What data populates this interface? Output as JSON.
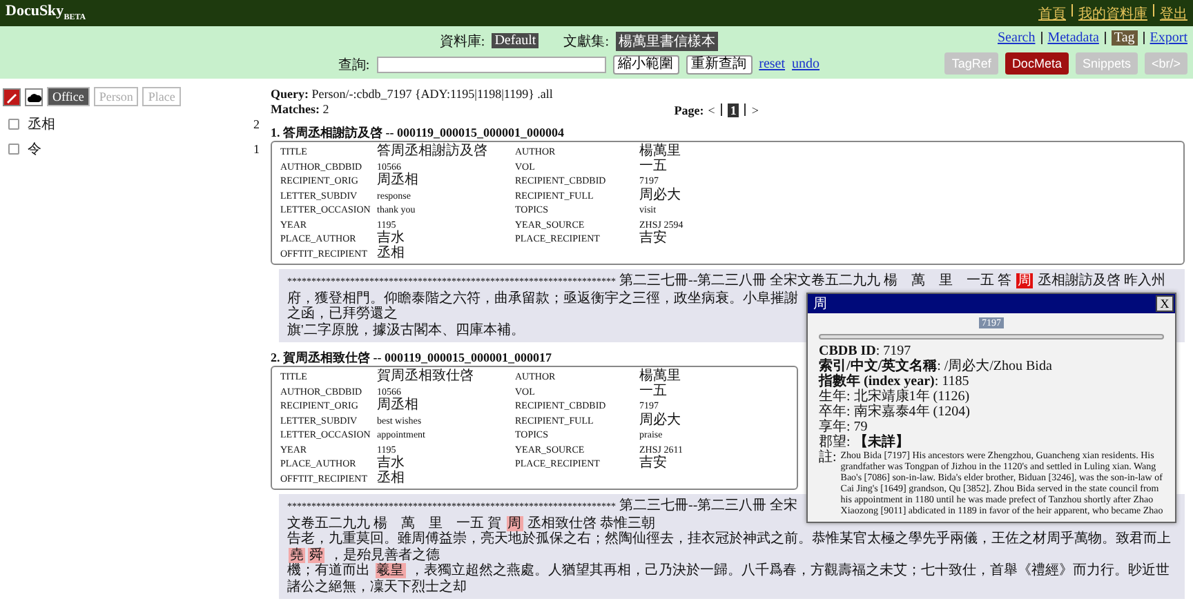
{
  "app": {
    "name": "DocuSky",
    "badge": "BETA"
  },
  "top_links": [
    "首頁",
    "我的資料庫",
    "登出"
  ],
  "database": {
    "label": "資料庫:",
    "value": "Default"
  },
  "corpus": {
    "label": "文獻集:",
    "value": "楊萬里書信樣本"
  },
  "query_bar": {
    "label": "查詢:",
    "buttons": [
      "縮小範圍",
      "重新查詢"
    ],
    "links": [
      "reset",
      "undo"
    ]
  },
  "view_links": [
    {
      "label": "Search",
      "selected": false
    },
    {
      "label": "Metadata",
      "selected": false
    },
    {
      "label": "Tag",
      "selected": true
    },
    {
      "label": "Export",
      "selected": false
    }
  ],
  "tool_buttons": [
    {
      "label": "TagRef",
      "selected": false
    },
    {
      "label": "DocMeta",
      "selected": true
    },
    {
      "label": "Snippets",
      "selected": false
    },
    {
      "label": "<br/>",
      "selected": false
    }
  ],
  "sidebar": {
    "tabs": [
      {
        "label": "Office",
        "selected": true
      },
      {
        "label": "Person",
        "selected": false
      },
      {
        "label": "Place",
        "selected": false
      }
    ],
    "items": [
      {
        "label": "丞相",
        "count": "2",
        "checked": false
      },
      {
        "label": "令",
        "count": "1",
        "checked": false
      }
    ]
  },
  "query": {
    "label": "Query:",
    "value": "Person/-:cbdb_7197 {ADY:1195|1198|1199} .all"
  },
  "matches": {
    "label": "Matches:",
    "value": "2"
  },
  "pager": {
    "label": "Page:",
    "prev": "<",
    "pages": [
      {
        "label": "1",
        "selected": true
      }
    ],
    "next": ">"
  },
  "records": [
    {
      "heading": "1. 答周丞相謝訪及啓 -- 000119_000015_000001_000004",
      "fields": [
        {
          "name": "TITLE",
          "value": "答周丞相謝訪及啓"
        },
        {
          "name": "AUTHOR",
          "value": "楊萬里"
        },
        {
          "name": "AUTHOR_CBDBID",
          "value": "10566"
        },
        {
          "name": "VOL",
          "value": "一五"
        },
        {
          "name": "RECIPIENT_ORIG",
          "value": "周丞相"
        },
        {
          "name": "RECIPIENT_CBDBID",
          "value": "7197"
        },
        {
          "name": "LETTER_SUBDIV",
          "value": "response"
        },
        {
          "name": "RECIPIENT_FULL",
          "value": "周必大"
        },
        {
          "name": "LETTER_OCCASION",
          "value": "thank you"
        },
        {
          "name": "TOPICS",
          "value": "visit"
        },
        {
          "name": "YEAR",
          "value": "1195"
        },
        {
          "name": "YEAR_SOURCE",
          "value": "ZHSJ 2594"
        },
        {
          "name": "PLACE_AUTHOR",
          "value": "吉水"
        },
        {
          "name": "PLACE_RECIPIENT",
          "value": "吉安"
        },
        {
          "name": "OFFTIT_RECIPIENT",
          "value": "丞相"
        }
      ],
      "snippet": [
        [
          {
            "kind": "stars",
            "text": "********************************************************************"
          },
          {
            "kind": "text",
            "text": " 第二三七冊--第二三八冊 全宋文卷五二九九 楊　萬　里　一五 答 "
          },
          {
            "kind": "person",
            "text": "周",
            "selected": true
          },
          {
            "kind": "text",
            "text": " 丞相謝訪及啓 昨入州"
          }
        ],
        [
          {
            "kind": "text",
            "text": "府，獲登相門。仰瞻泰階之六符，曲承留款；亟返衡宇之三徑，政坐病衰。小阜摧謝之函，已拜勞還之"
          }
        ],
        [
          {
            "kind": "text",
            "text": "旗'二字原脫，據汲古閣本、四庫本補。"
          }
        ]
      ]
    },
    {
      "heading": "2. 賀周丞相致仕啓 -- 000119_000015_000001_000017",
      "fields": [
        {
          "name": "TITLE",
          "value": "賀周丞相致仕啓"
        },
        {
          "name": "AUTHOR",
          "value": "楊萬里"
        },
        {
          "name": "AUTHOR_CBDBID",
          "value": "10566"
        },
        {
          "name": "VOL",
          "value": "一五"
        },
        {
          "name": "RECIPIENT_ORIG",
          "value": "周丞相"
        },
        {
          "name": "RECIPIENT_CBDBID",
          "value": "7197"
        },
        {
          "name": "LETTER_SUBDIV",
          "value": "best wishes"
        },
        {
          "name": "RECIPIENT_FULL",
          "value": "周必大"
        },
        {
          "name": "LETTER_OCCASION",
          "value": "appointment"
        },
        {
          "name": "TOPICS",
          "value": "praise"
        },
        {
          "name": "YEAR",
          "value": "1195"
        },
        {
          "name": "YEAR_SOURCE",
          "value": "ZHSJ 2611"
        },
        {
          "name": "PLACE_AUTHOR",
          "value": "吉水"
        },
        {
          "name": "PLACE_RECIPIENT",
          "value": "吉安"
        },
        {
          "name": "OFFTIT_RECIPIENT",
          "value": "丞相"
        }
      ],
      "snippet": [
        [
          {
            "kind": "stars",
            "text": "********************************************************************"
          },
          {
            "kind": "text",
            "text": " 第二三七冊--第二三八冊 全宋文卷五二九九 楊　萬　里　一五 賀 "
          },
          {
            "kind": "person",
            "text": "周",
            "selected": false
          },
          {
            "kind": "text",
            "text": " 丞相致仕啓 恭惟三朝"
          }
        ],
        [
          {
            "kind": "text",
            "text": "告老，九重莫回。雖周傅益崇，亮天地於孤保之右；然陶仙徑去，挂衣冠於神武之前。恭惟某官太極之學先乎兩儀，王佐之材周乎萬物。致君而上 "
          },
          {
            "kind": "person",
            "text": "堯",
            "selected": false
          },
          {
            "kind": "person",
            "text": "舜",
            "selected": false
          },
          {
            "kind": "text",
            "text": " ，是殆見善者之德"
          }
        ],
        [
          {
            "kind": "text",
            "text": "機；有道而出 "
          },
          {
            "kind": "person",
            "text": "羲皇",
            "selected": false
          },
          {
            "kind": "text",
            "text": " ，表獨立超然之燕處。人猶望其再相，己乃決於一歸。八千爲春，方觀壽福之未艾；七十致仕，首舉《禮經》而力行。眇近世諸公之絕無，凜天下烈士之却"
          }
        ]
      ]
    }
  ],
  "popup": {
    "title": "周",
    "close": "X",
    "id_tag": "7197",
    "rows": [
      "**CBDB ID**: 7197",
      "**索引/中文/英文名稱**: /周必大/Zhou Bida",
      "**指數年 (index year)**: 1185",
      "生年: 北宋靖康1年 (1126)",
      "卒年: 南宋嘉泰4年 (1204)",
      "享年: 79",
      "郡望: **【未詳】**"
    ],
    "note": {
      "label": "註:",
      "text": "Zhou Bida [7197] His ancestors were Zhengzhou, Guancheng xian residents. His grandfather was Tongpan of Jizhou in the 1120's and settled in Luling xian. Wang Bao's [7086] son-in-law. Bida's elder brother, Biduan [3246], was the son-in-law of Cai Jing's [1649] grandson, Qu [3852]. Zhou Bida served in the state council from his appointment in 1180 until he was made prefect of Tanzhou shortly after Zhao Xiaozong [9011] abdicated in 1189 in favor of the heir apparent, who became Zhao"
    }
  }
}
